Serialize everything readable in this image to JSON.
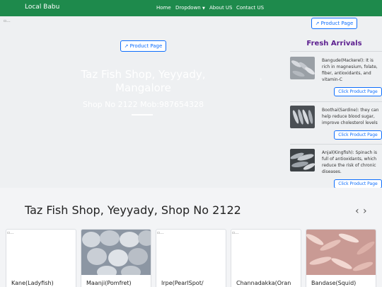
{
  "navbar": {
    "brand": "Local Babu",
    "links": [
      "Home",
      "Dropdown",
      "About US",
      "Contact US"
    ]
  },
  "broken_image_alt": "...",
  "hero": {
    "button_label": "Product Page",
    "title": "Taz Fish Shop, Yeyyady, Mangalore",
    "subtitle": "Shop No 2122 Mob:987654328"
  },
  "sidebar": {
    "top_button_label": "Product Page",
    "title": "Fresh Arrivals",
    "items": [
      {
        "description": "Bangude(Mackerel): It is rich in magnesium, folate, fiber, antioxidants, and vitamin-C",
        "button": "Click Product Page"
      },
      {
        "description": "Boothai(Sardine): they can help reduce blood sugar, improve cholesterol levels",
        "button": "Click Product Page"
      },
      {
        "description": "Anjal(Kingfish): Spinach is full of antioxidants, which reduce the risk of chronic diseases.",
        "button": "Click Product Page"
      }
    ]
  },
  "section": {
    "title": "Taz Fish Shop, Yeyyady, Shop No 2122"
  },
  "cards": [
    {
      "name": "Kane(Ladyfish)"
    },
    {
      "name": "Maanji(Pomfret)"
    },
    {
      "name": "Irpe(PearlSpot/"
    },
    {
      "name": "Channadakka(Oran"
    },
    {
      "name": "Bandase(Squid)"
    }
  ],
  "colors": {
    "navbar": "#1e8a4c",
    "accent": "#0d6efd",
    "fresh_title": "#5c1f8f"
  }
}
